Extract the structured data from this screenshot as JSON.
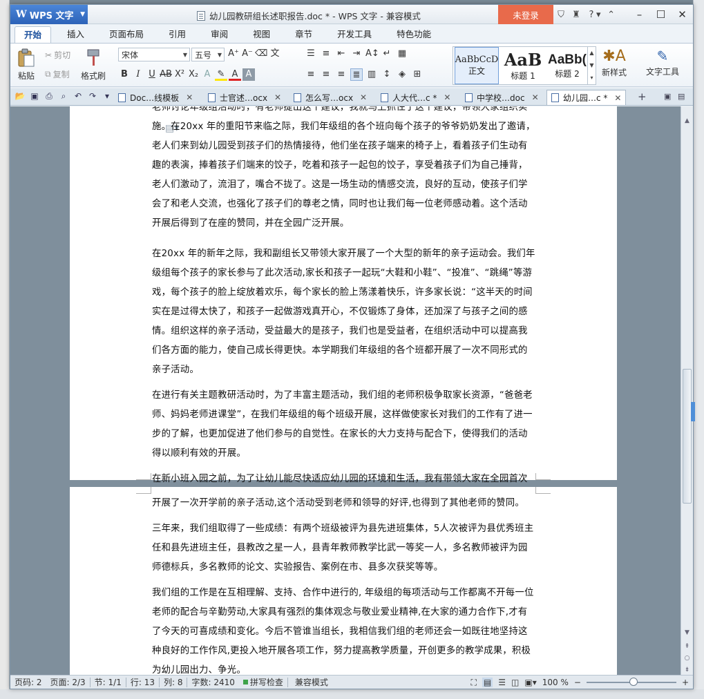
{
  "app": {
    "name": "WPS 文字",
    "window_title": "幼儿园教研组长述职报告.doc * - WPS 文字 - 兼容模式",
    "login_label": "未登录",
    "help_label": "?"
  },
  "ribbon_tabs": [
    "开始",
    "插入",
    "页面布局",
    "引用",
    "审阅",
    "视图",
    "章节",
    "开发工具",
    "特色功能"
  ],
  "ribbon": {
    "paste": "粘贴",
    "cut": "剪切",
    "copy": "复制",
    "format_painter": "格式刷",
    "font_name": "宋体",
    "font_size": "五号",
    "styles": [
      {
        "preview": "AaBbCcD",
        "label": "正文"
      },
      {
        "preview": "AaB",
        "label": "标题 1"
      },
      {
        "preview": "AaBb(",
        "label": "标题 2"
      }
    ],
    "new_style": "新样式",
    "text_tools": "文字工具"
  },
  "doc_tabs": [
    {
      "label": "Doc…线模板",
      "active": false
    },
    {
      "label": "士官述…ocx",
      "active": false
    },
    {
      "label": "怎么写…ocx",
      "active": false
    },
    {
      "label": "人大代…c *",
      "active": false
    },
    {
      "label": "中学校…doc",
      "active": false
    },
    {
      "label": "幼儿园…c *",
      "active": true
    }
  ],
  "document": {
    "page1_paragraphs": [
      "老师讨论年级组活动时，有老师提出这个建议，我就马上抓住了这个建议，带领大家组织实施。在20xx 年的重阳节来临之际，我们年级组的各个班向每个孩子的爷爷奶奶发出了邀请，老人们来到幼儿园受到孩子们的热情接待，他们坐在孩子端来的椅子上，看着孩子们生动有趣的表演，捧着孩子们端来的饺子，吃着和孩子一起包的饺子，享受着孩子们为自己捶背，老人们激动了，流泪了，嘴合不拢了。这是一场生动的情感交流，良好的互动，使孩子们学会了和老人交流，也强化了孩子们的尊老之情，同时也让我们每一位老师感动着。这个活动开展后得到了在座的赞同，并在全园广泛开展。",
      "在20xx 年的新年之际，我和副组长又带领大家开展了一个大型的新年的亲子运动会。我们年级组每个孩子的家长参与了此次活动,家长和孩子一起玩“大鞋和小鞋”、“投准”、“跳绳”等游戏，每个孩子的脸上绽放着欢乐，每个家长的脸上荡漾着快乐，许多家长说：“这半天的时间实在是过得太快了，和孩子一起做游戏真开心，不仅锻炼了身体，还加深了与孩子之间的感情。组织这样的亲子活动，受益最大的是孩子，我们也是受益者，在组织活动中可以提高我们各方面的能力，使自己成长得更快。本学期我们年级组的各个班都开展了一次不同形式的亲子活动。",
      "在进行有关主题教研活动时，为了丰富主题活动，我们组的老师积极争取家长资源，“爸爸老师、妈妈老师进课堂”，在我们年级组的每个班级开展，这样做使家长对我们的工作有了进一步的了解，也更加促进了他们参与的自觉性。在家长的大力支持与配合下，使得我们的活动得以顺利有效的开展。",
      "在新小班入园之前，为了让幼儿能尽快适应幼儿园的环境和生活，我有带领大家在全园首次"
    ],
    "page2_paragraphs": [
      "开展了一次开学前的亲子活动,这个活动受到老师和领导的好评,也得到了其他老师的赞同。",
      "三年来，我们组取得了一些成绩：有两个班级被评为县先进班集体，5人次被评为县优秀班主任和县先进班主任，县教改之星一人，县青年教师教学比武一等奖一人，多名教师被评为园师德标兵，多名教师的论文、实验报告、案例在市、县多次获奖等等。",
      "我们组的工作是在互相理解、支持、合作中进行的, 年级组的每项活动与工作都离不开每一位老师的配合与辛勤劳动,大家具有强烈的集体观念与敬业爱业精神,在大家的通力合作下,才有了今天的可喜成绩和变化。今后不管谁当组长，我相信我们组的老师还会一如既往地坚持这种良好的工作作风,更投入地开展各项工作，努力提高教学质量，开创更多的教学成果，积极为幼儿园出力、争光。"
    ]
  },
  "status": {
    "page_code": "页码: 2",
    "pages": "页面: 2/3",
    "section": "节: 1/1",
    "line": "行: 13",
    "column": "列: 8",
    "word_count": "字数: 2410",
    "spell_check": "拼写检查",
    "compat_mode": "兼容模式",
    "zoom": "100 %",
    "zoom_level_percent": 100
  }
}
